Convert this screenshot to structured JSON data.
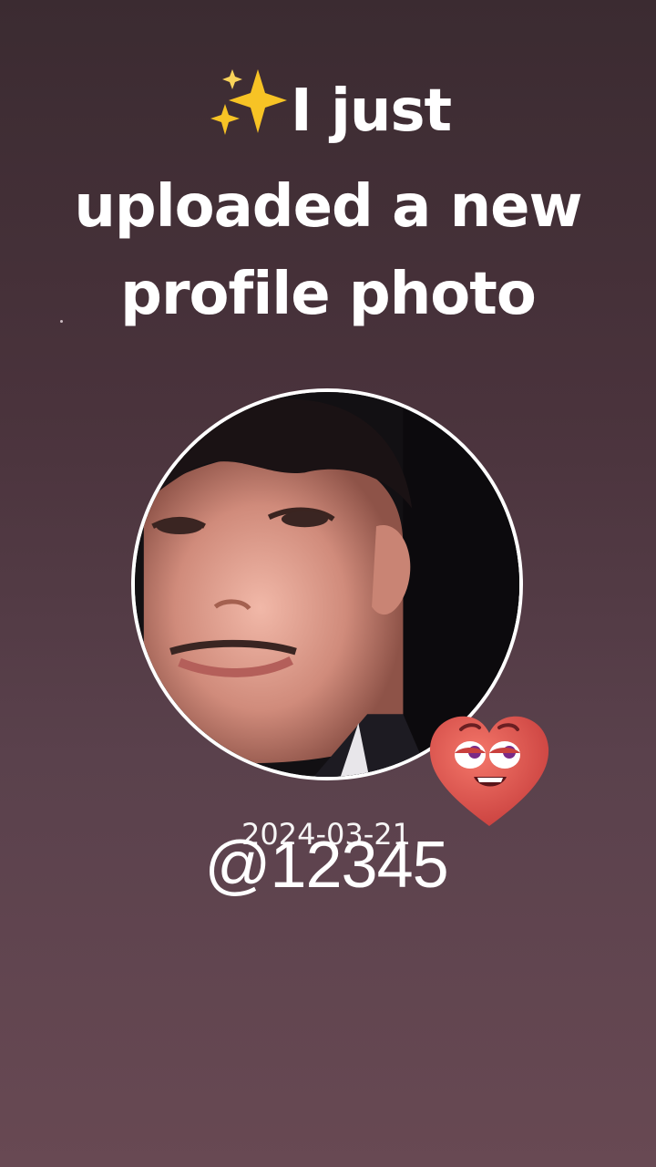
{
  "headline": {
    "line1_text": "I just",
    "line2": "uploaded a new",
    "line3": "profile photo",
    "sparkle_icon": "sparkles-icon"
  },
  "profile": {
    "avatar_icon": "profile-photo",
    "sticker_icon": "heart-face-sticker"
  },
  "date": "2024-03-21",
  "handle": "@12345",
  "colors": {
    "bg_top": "#3b2b31",
    "bg_bottom": "#684953",
    "sparkle": "#f7c325",
    "heart": "#e2584f",
    "text": "#ffffff"
  }
}
